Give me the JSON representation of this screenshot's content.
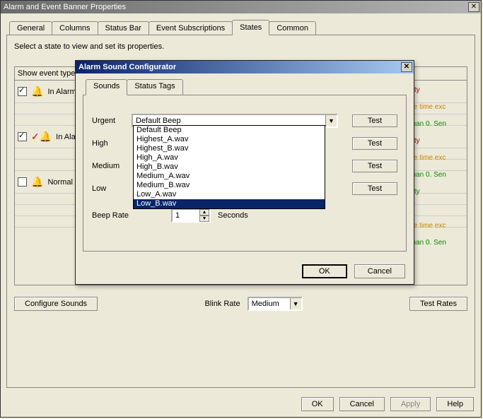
{
  "window": {
    "title": "Alarm and Event Banner Properties",
    "tabs": [
      "General",
      "Columns",
      "Status Bar",
      "Event Subscriptions",
      "States",
      "Common"
    ],
    "active_tab": "States",
    "hint": "Select a state to view and set its properties.",
    "header_label": "Show event type",
    "states": [
      {
        "checked": true,
        "icon": "bell-red",
        "label": "In Alarm"
      },
      {
        "checked": true,
        "icon": "bell-ack",
        "label": "In Alarm ."
      },
      {
        "checked": false,
        "icon": "bell-blue",
        "label": "Normal L"
      }
    ],
    "right_rows": [
      {
        "text": "mpty",
        "cls": "rc-red"
      },
      {
        "text": "lose time exc",
        "cls": "rc-orange"
      },
      {
        "text": "s than 0.  Sen",
        "cls": "rc-green"
      },
      {
        "text": "mpty",
        "cls": "rc-red"
      },
      {
        "text": "lose time exc",
        "cls": "rc-orange"
      },
      {
        "text": "s than 0.  Sen",
        "cls": "rc-green"
      },
      {
        "text": "mpty",
        "cls": "rc-green"
      },
      {
        "text": "",
        "cls": ""
      },
      {
        "text": "lose time exc",
        "cls": "rc-orange"
      },
      {
        "text": "s than 0.  Sen",
        "cls": "rc-green"
      }
    ],
    "configure_sounds_btn": "Configure Sounds",
    "blink_rate_label": "Blink Rate",
    "blink_rate_value": "Medium",
    "test_rates_btn": "Test Rates",
    "buttons": {
      "ok": "OK",
      "cancel": "Cancel",
      "apply": "Apply",
      "help": "Help"
    }
  },
  "dialog": {
    "title": "Alarm Sound Configurator",
    "tabs": [
      "Sounds",
      "Status Tags"
    ],
    "active_tab": "Sounds",
    "rows": [
      {
        "label": "Urgent",
        "value": "Default Beep"
      },
      {
        "label": "High",
        "value": ""
      },
      {
        "label": "Medium",
        "value": ""
      },
      {
        "label": "Low",
        "value": ""
      }
    ],
    "dropdown_options": [
      "Default Beep",
      "Highest_A.wav",
      "Highest_B.wav",
      "High_A.wav",
      "High_B.wav",
      "Medium_A.wav",
      "Medium_B.wav",
      "Low_A.wav",
      "Low_B.wav"
    ],
    "dropdown_selected": "Low_B.wav",
    "test_label": "Test",
    "beep_rate_label": "Beep Rate",
    "beep_rate_value": "1",
    "beep_rate_unit": "Seconds",
    "buttons": {
      "ok": "OK",
      "cancel": "Cancel"
    }
  }
}
